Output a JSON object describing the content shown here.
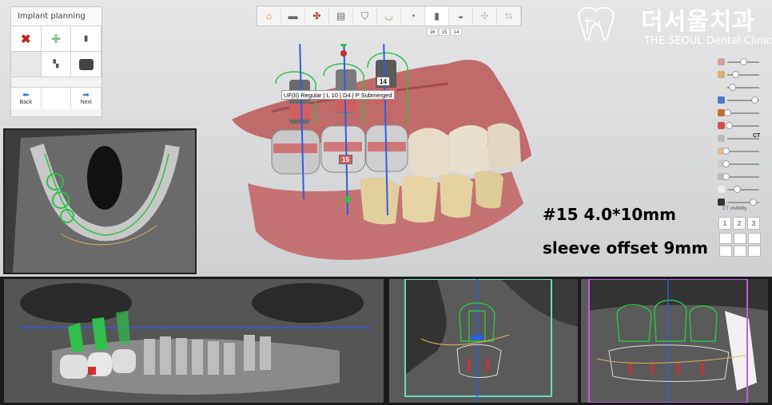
{
  "panel": {
    "title": "Implant planning",
    "back_label": "Back",
    "next_label": "Next"
  },
  "toolbar": {
    "items": [
      "home-icon",
      "guide-icon",
      "nerve-icon",
      "edit-icon",
      "scan-icon",
      "arch-icon",
      "tooth-icon",
      "implant-icon",
      "sleeve-icon",
      "guide-design-icon",
      "export-icon"
    ]
  },
  "tooth_selector": [
    "16",
    "15",
    "14"
  ],
  "logo": {
    "korean": "더서울치과",
    "english": "THE SEOUL Dental Clinic"
  },
  "implant_label": "UF(II) Regular | L 10 | D4 | P Submerged",
  "implant_numbers": {
    "a": "14",
    "b": "15"
  },
  "annotation": {
    "line1": "#15 4.0*10mm",
    "line2": "sleeve offset 9mm"
  },
  "ct_label": "CT",
  "ct_visibility_label": "CT visibility",
  "layout_buttons": [
    "1",
    "2",
    "3"
  ],
  "colors": {
    "logo": "#ffffff",
    "implant_green": "#2fbf4a",
    "axis_blue": "#2f5de0",
    "toolbar_accent": "#e07020",
    "section_frame_cyan": "#60e0c0",
    "section_frame_magenta": "#c060e0"
  }
}
